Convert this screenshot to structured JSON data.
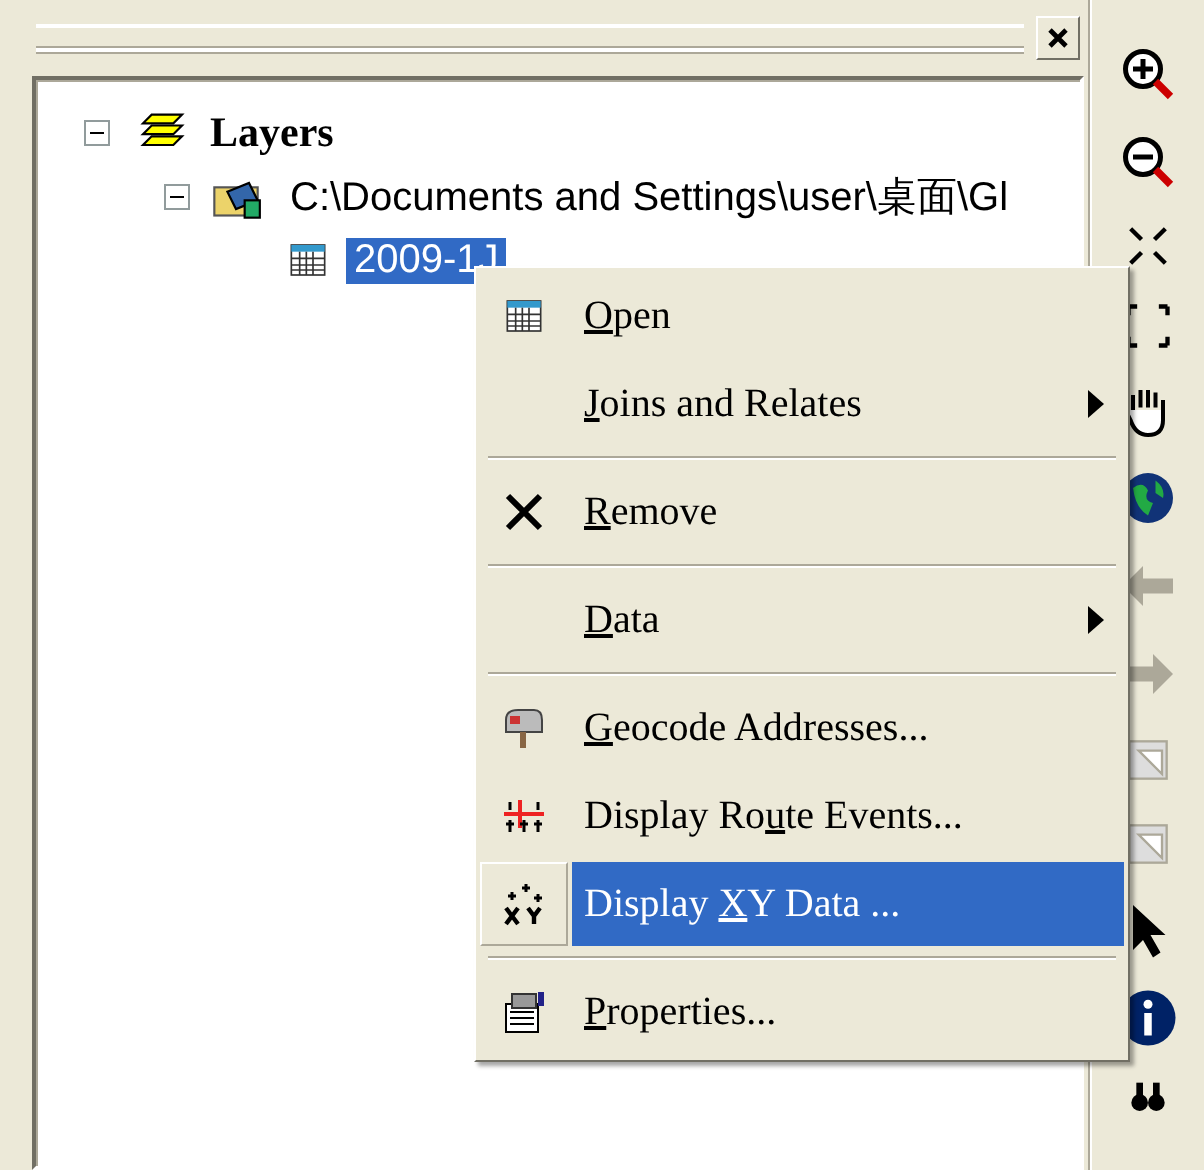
{
  "toc": {
    "tree": [
      {
        "label": "Layers",
        "kind": "frame",
        "expanded": true,
        "children": [
          {
            "label": "C:\\Documents and Settings\\user\\桌面\\Gl",
            "kind": "workspace",
            "expanded": true,
            "children": [
              {
                "label": "2009-1J",
                "kind": "table",
                "selected": true
              }
            ]
          }
        ]
      }
    ]
  },
  "context_menu": {
    "items": [
      {
        "kind": "item",
        "key": "O",
        "after": "pen",
        "submenu": false,
        "selected": false
      },
      {
        "kind": "item",
        "key": "J",
        "after": "oins and Relates",
        "submenu": true,
        "selected": false
      },
      {
        "kind": "separator"
      },
      {
        "kind": "item",
        "key": "R",
        "after": "emove",
        "submenu": false,
        "selected": false
      },
      {
        "kind": "separator"
      },
      {
        "kind": "item",
        "key": "D",
        "after": "ata",
        "submenu": true,
        "selected": false
      },
      {
        "kind": "separator"
      },
      {
        "kind": "item",
        "key": "G",
        "after": "eocode Addresses...",
        "submenu": false,
        "selected": false
      },
      {
        "kind": "item",
        "before": "Display Ro",
        "key": "u",
        "after": "te Events...",
        "submenu": false,
        "selected": false
      },
      {
        "kind": "item",
        "before": "Display ",
        "key": "X",
        "after": "Y Data ...",
        "submenu": false,
        "selected": true
      },
      {
        "kind": "separator"
      },
      {
        "kind": "item",
        "key": "P",
        "after": "roperties...",
        "submenu": false,
        "selected": false
      }
    ]
  }
}
